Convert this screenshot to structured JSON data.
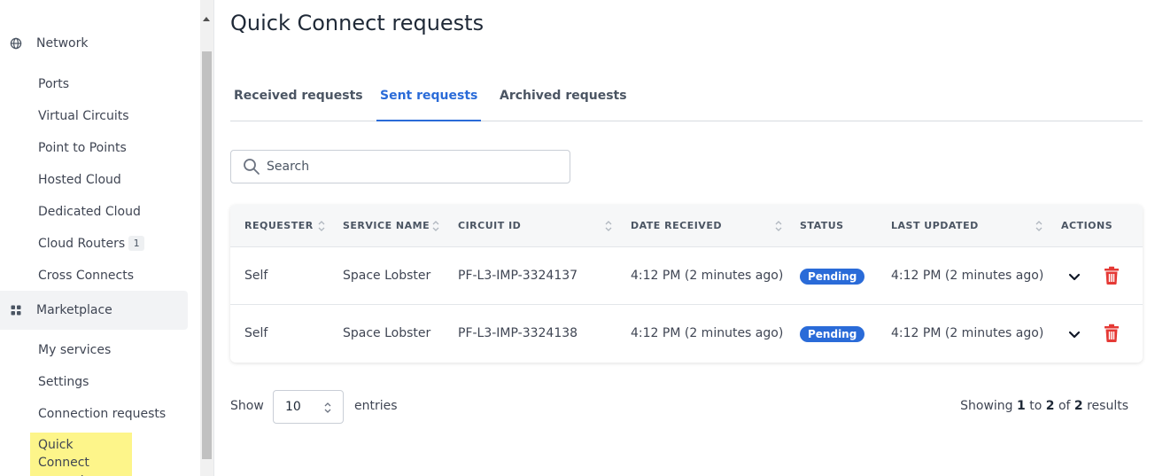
{
  "sidebar": {
    "network": {
      "label": "Network",
      "icon": "globe-icon"
    },
    "network_items": [
      {
        "label": "Ports"
      },
      {
        "label": "Virtual Circuits"
      },
      {
        "label": "Point to Points"
      },
      {
        "label": "Hosted Cloud"
      },
      {
        "label": "Dedicated Cloud"
      },
      {
        "label": "Cloud Routers",
        "badge": "1"
      },
      {
        "label": "Cross Connects"
      }
    ],
    "marketplace": {
      "label": "Marketplace",
      "icon": "grid-icon"
    },
    "marketplace_items": [
      {
        "label": "My services"
      },
      {
        "label": "Settings"
      },
      {
        "label": "Connection requests"
      },
      {
        "label": "Quick Connect requests"
      }
    ]
  },
  "page": {
    "title": "Quick Connect requests"
  },
  "tabs": [
    {
      "label": "Received requests"
    },
    {
      "label": "Sent requests",
      "active": true
    },
    {
      "label": "Archived requests"
    }
  ],
  "search": {
    "placeholder": "Search",
    "value": ""
  },
  "table": {
    "headers": {
      "requester": "REQUESTER",
      "service_name": "SERVICE NAME",
      "circuit_id": "CIRCUIT ID",
      "date_received": "DATE RECEIVED",
      "status": "STATUS",
      "last_updated": "LAST UPDATED",
      "actions": "ACTIONS"
    },
    "rows": [
      {
        "requester": "Self",
        "service_name": "Space Lobster",
        "circuit_id": "PF-L3-IMP-3324137",
        "date_received": "4:12 PM (2 minutes ago)",
        "status": "Pending",
        "last_updated": "4:12 PM (2 minutes ago)"
      },
      {
        "requester": "Self",
        "service_name": "Space Lobster",
        "circuit_id": "PF-L3-IMP-3324138",
        "date_received": "4:12 PM (2 minutes ago)",
        "status": "Pending",
        "last_updated": "4:12 PM (2 minutes ago)"
      }
    ]
  },
  "footer": {
    "show_label": "Show",
    "page_size": "10",
    "entries_label": "entries",
    "results_prefix": "Showing",
    "results_from": "1",
    "results_to_word": "to",
    "results_to": "2",
    "results_of_word": "of",
    "results_total": "2",
    "results_suffix": "results"
  },
  "colors": {
    "accent": "#2a6bd8",
    "highlight": "#fdf58a",
    "delete": "#e53935",
    "status_pending": "#2a6bd8"
  }
}
